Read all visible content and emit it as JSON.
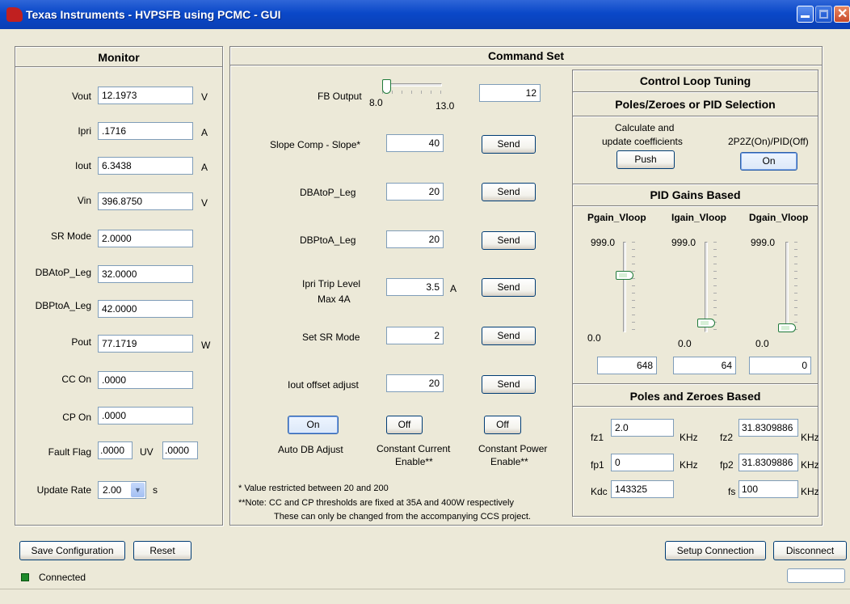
{
  "window": {
    "title": "Texas Instruments - HVPSFB using PCMC - GUI"
  },
  "monitor": {
    "title": "Monitor",
    "fields": [
      {
        "label": "Vout",
        "value": "12.1973",
        "unit": "V"
      },
      {
        "label": "Ipri",
        "value": ".1716",
        "unit": "A"
      },
      {
        "label": "Iout",
        "value": "6.3438",
        "unit": "A"
      },
      {
        "label": "Vin",
        "value": "396.8750",
        "unit": "V"
      },
      {
        "label": "SR Mode",
        "value": "2.0000",
        "unit": ""
      },
      {
        "label": "DBAtoP_Leg",
        "value": "32.0000",
        "unit": ""
      },
      {
        "label": "DBPtoA_Leg",
        "value": "42.0000",
        "unit": ""
      },
      {
        "label": "Pout",
        "value": "77.1719",
        "unit": "W"
      },
      {
        "label": "CC On",
        "value": ".0000",
        "unit": ""
      },
      {
        "label": "CP On",
        "value": ".0000",
        "unit": ""
      }
    ],
    "fault_flag": {
      "label": "Fault Flag",
      "value": ".0000",
      "uv_label": "UV",
      "uv_value": ".0000"
    },
    "update_rate": {
      "label": "Update Rate",
      "value": "2.00",
      "unit": "s"
    }
  },
  "command_set": {
    "title": "Command Set",
    "fb_output": {
      "label": "FB Output",
      "min": "8.0",
      "max": "13.0",
      "value": "12",
      "level": 0.0
    },
    "rows": [
      {
        "label": "Slope Comp - Slope*",
        "value": "40",
        "unit": "",
        "button": "Send"
      },
      {
        "label": "DBAtoP_Leg",
        "value": "20",
        "unit": "",
        "button": "Send"
      },
      {
        "label": "DBPtoA_Leg",
        "value": "20",
        "unit": "",
        "button": "Send"
      },
      {
        "label": "Ipri Trip Level",
        "label2": "Max 4A",
        "value": "3.5",
        "unit": "A",
        "button": "Send"
      },
      {
        "label": "Set SR Mode",
        "value": "2",
        "unit": "",
        "button": "Send"
      },
      {
        "label": "Iout offset adjust",
        "value": "20",
        "unit": "",
        "button": "Send"
      }
    ],
    "toggles": [
      {
        "button": "On",
        "label": "Auto DB Adjust",
        "label2": ""
      },
      {
        "button": "Off",
        "label": "Constant Current",
        "label2": "Enable**"
      },
      {
        "button": "Off",
        "label": "Constant Power",
        "label2": "Enable**"
      }
    ],
    "notes": [
      "* Value restricted between 20 and 200",
      "**Note: CC and CP thresholds are fixed  at 35A and 400W respectively",
      "These can only be changed from the accompanying CCS project."
    ]
  },
  "control_loop": {
    "title": "Control Loop Tuning",
    "selection": {
      "title": "Poles/Zeroes or PID Selection",
      "calc_label_1": "Calculate and",
      "calc_label_2": "update coefficients",
      "push_button": "Push",
      "mode_label": "2P2Z(On)/PID(Off)",
      "mode_button": "On"
    },
    "pid": {
      "title": "PID Gains Based",
      "sliders": [
        {
          "label": "Pgain_Vloop",
          "max": "999.0",
          "min": "0.0",
          "value": "648",
          "level": 0.648
        },
        {
          "label": "Igain_Vloop",
          "max": "999.0",
          "min": "0.0",
          "value": "64",
          "level": 0.064
        },
        {
          "label": "Dgain_Vloop",
          "max": "999.0",
          "min": "0.0",
          "value": "0",
          "level": 0.0
        }
      ]
    },
    "pz": {
      "title": "Poles and Zeroes Based",
      "fz1": {
        "label": "fz1",
        "value": "2.0",
        "unit": "KHz"
      },
      "fz2": {
        "label": "fz2",
        "value": "31.8309886",
        "unit": "KHz"
      },
      "fp1": {
        "label": "fp1",
        "value": "0",
        "unit": "KHz"
      },
      "fp2": {
        "label": "fp2",
        "value": "31.8309886",
        "unit": "KHz"
      },
      "kdc": {
        "label": "Kdc",
        "value": "143325"
      },
      "fs": {
        "label": "fs",
        "value": "100",
        "unit": "KHz"
      }
    }
  },
  "footer": {
    "save": "Save Configuration",
    "reset": "Reset",
    "setup": "Setup Connection",
    "disconnect": "Disconnect",
    "status": "Connected"
  },
  "colors": {
    "titlebar": "#0a48c8",
    "connected_led": "#1f8a2a",
    "slider_thumb": "#1f7a3a"
  }
}
